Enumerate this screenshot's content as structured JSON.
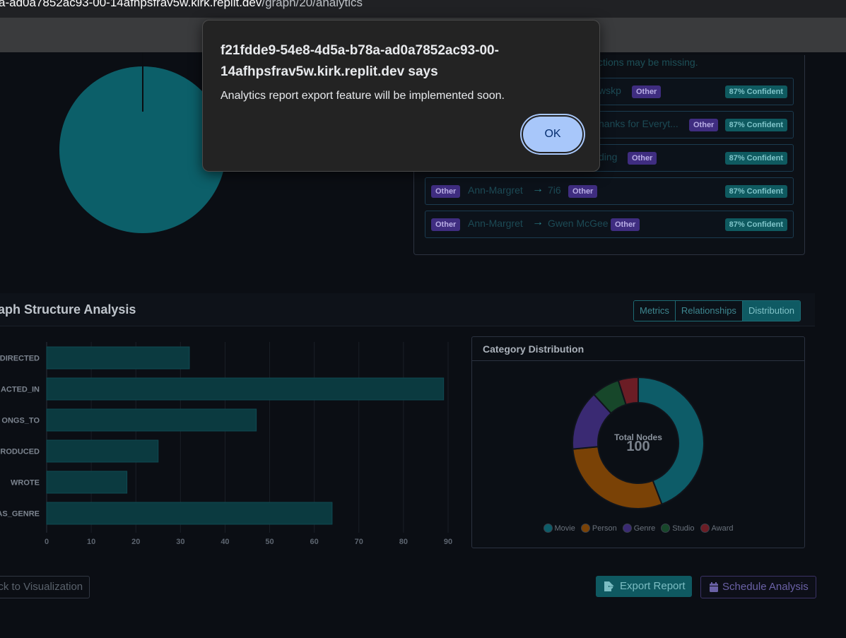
{
  "browser": {
    "url_host": "a-ad0a7852ac93-00-14afhpsfrav5w.kirk.replit.dev",
    "url_path": "/graph/20/analytics"
  },
  "insights": {
    "note": "ctions may be missing.",
    "rows": [
      {
        "source_tag": "",
        "source": "",
        "target": "wskp",
        "target_tag": "Other",
        "confidence": "87% Confident"
      },
      {
        "source_tag": "",
        "source": "",
        "target": "hanks for Everyt...",
        "target_tag": "Other",
        "confidence": "87% Confident"
      },
      {
        "source_tag": "",
        "source": "",
        "target": "ding",
        "target_tag": "Other",
        "confidence": "87% Confident"
      },
      {
        "source_tag": "Other",
        "source": "Ann-Margret",
        "target": "7i6",
        "target_tag": "Other",
        "confidence": "87% Confident"
      },
      {
        "source_tag": "Other",
        "source": "Ann-Margret",
        "target": "Gwen McGee",
        "target_tag": "Other",
        "confidence": "87% Confident"
      }
    ]
  },
  "structure": {
    "title": "aph Structure Analysis",
    "tabs": [
      {
        "label": "Metrics",
        "active": false
      },
      {
        "label": "Relationships",
        "active": false
      },
      {
        "label": "Distribution",
        "active": true
      }
    ]
  },
  "chart_data": [
    {
      "type": "bar",
      "orientation": "horizontal",
      "categories": [
        "DIRECTED",
        "ACTED_IN",
        "ONGS_TO",
        "RODUCED",
        "WROTE",
        "AS_GENRE"
      ],
      "values": [
        32,
        89,
        47,
        25,
        18,
        64
      ],
      "xticks": [
        "0",
        "10",
        "20",
        "30",
        "40",
        "50",
        "60",
        "70",
        "80",
        "90"
      ],
      "xlim": [
        0,
        90
      ],
      "grid": true,
      "color": "#0b3a40"
    },
    {
      "type": "pie",
      "title": "Category Distribution",
      "center_label": "Total Nodes",
      "center_value": "100",
      "categories": [
        "Movie",
        "Person",
        "Genre",
        "Studio",
        "Award"
      ],
      "values": [
        45,
        30,
        15,
        7,
        5
      ],
      "colors": [
        "#0d5c68",
        "#7a4206",
        "#3a2a73",
        "#17472a",
        "#6b1d25"
      ]
    }
  ],
  "buttons": {
    "back": "ack to Visualization",
    "export": "Export Report",
    "schedule": "Schedule Analysis"
  },
  "dialog": {
    "title": "f21fdde9-54e8-4d5a-b78a-ad0a7852ac93-00-14afhpsfrav5w.kirk.replit.dev says",
    "message": "Analytics report export feature will be implemented soon.",
    "ok_label": "OK"
  }
}
